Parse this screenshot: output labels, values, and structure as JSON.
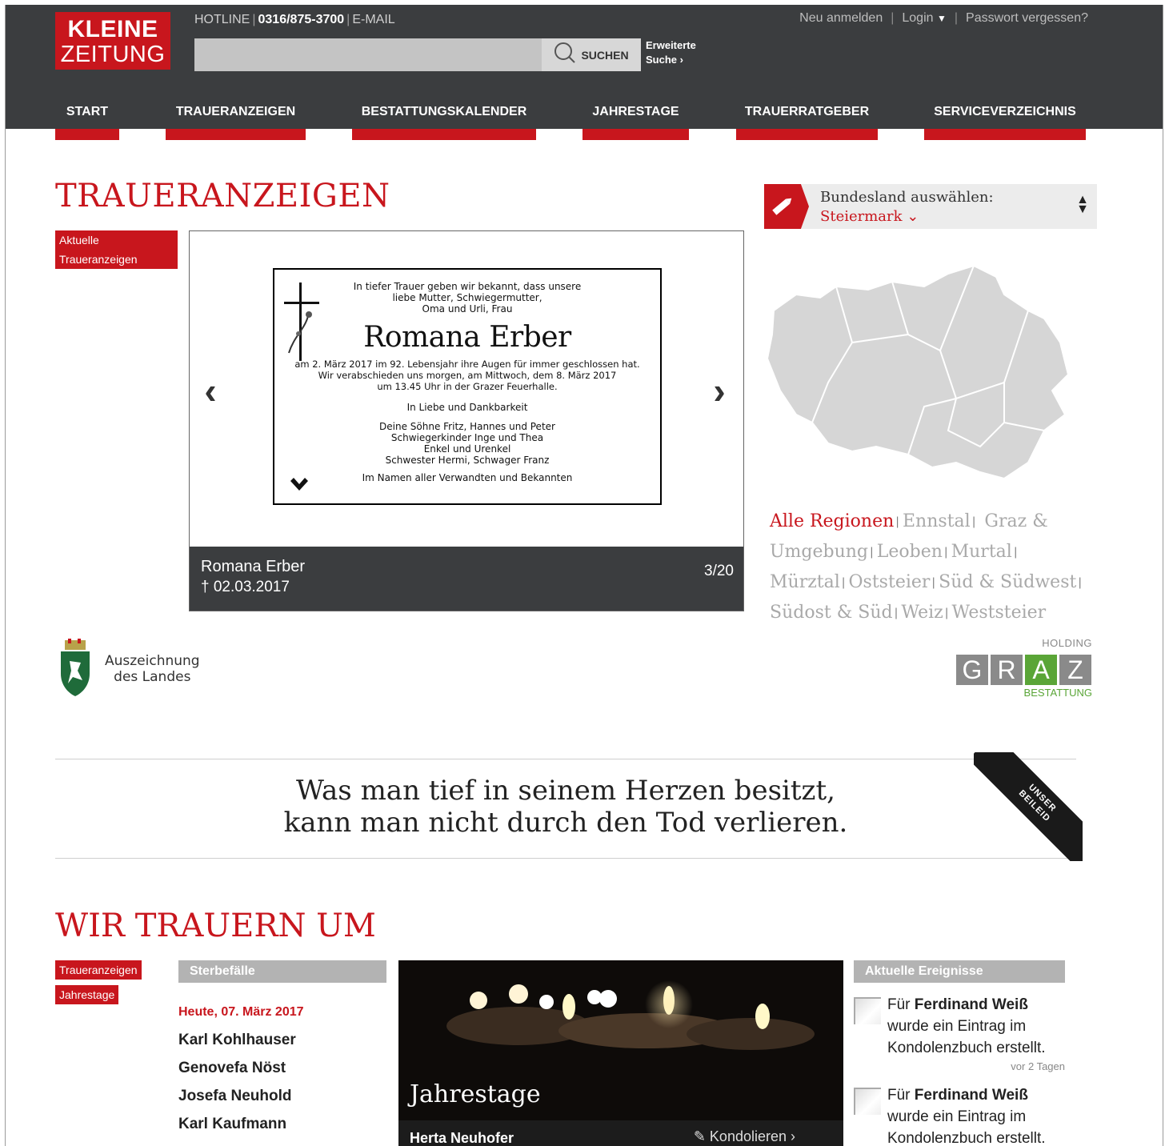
{
  "header": {
    "logo_line1": "KLEINE",
    "logo_line2": "ZEITUNG",
    "hotline_label": "HOTLINE",
    "hotline_number": "0316/875-3700",
    "email_label": "E-MAIL",
    "search_placeholder": "",
    "search_button": "SUCHEN",
    "advanced_line1": "Erweiterte",
    "advanced_line2": "Suche ›",
    "register": "Neu anmelden",
    "login": "Login",
    "forgot_password": "Passwort vergessen?"
  },
  "nav": [
    {
      "label": "START"
    },
    {
      "label": "TRAUERANZEIGEN"
    },
    {
      "label": "BESTATTUNGSKALENDER"
    },
    {
      "label": "JAHRESTAGE"
    },
    {
      "label": "TRAUERRATGEBER"
    },
    {
      "label": "SERVICEVERZEICHNIS"
    }
  ],
  "trauer": {
    "heading": "TRAUERANZEIGEN",
    "tag_line1": "Aktuelle",
    "tag_line2": "Traueranzeigen",
    "notice": {
      "intro": "In tiefer Trauer geben wir bekannt, dass unsere\nliebe Mutter, Schwiegermutter,\nOma und Urli, Frau",
      "name": "Romana Erber",
      "body": "am 2. März 2017 im 92. Lebensjahr ihre Augen für immer geschlossen hat.\nWir verabschieden uns morgen, am Mittwoch, dem 8. März 2017\num 13.45 Uhr in der Grazer Feuerhalle.",
      "thanks": "In Liebe und Dankbarkeit",
      "family": "Deine Söhne Fritz, Hannes und Peter\nSchwiegerkinder Inge und Thea\nEnkel und Urenkel\nSchwester Hermi, Schwager Franz",
      "foot": "Im Namen aller Verwandten und Bekannten"
    },
    "caption_name": "Romana Erber",
    "caption_date": "† 02.03.2017",
    "counter": "3/20"
  },
  "region": {
    "label": "Bundesland auswählen:",
    "selected": "Steiermark ⌄",
    "items": [
      {
        "label": "Alle Regionen",
        "active": true
      },
      {
        "label": "Ennstal"
      },
      {
        "label": "Graz & Umgebung"
      },
      {
        "label": "Leoben"
      },
      {
        "label": "Murtal"
      },
      {
        "label": "Mürztal"
      },
      {
        "label": "Oststeier"
      },
      {
        "label": "Süd & Südwest"
      },
      {
        "label": "Südost & Süd"
      },
      {
        "label": "Weiz"
      },
      {
        "label": "Weststeier"
      }
    ]
  },
  "award": {
    "line1": "Auszeichnung",
    "line2": "des Landes"
  },
  "holding": {
    "top": "HOLDING",
    "letters": [
      "G",
      "R",
      "A",
      "Z"
    ],
    "bottom": "BESTATTUNG"
  },
  "quote": {
    "text": "Was man tief in seinem Herzen besitzt,\nkann man nicht durch den Tod verlieren.",
    "ribbon_line1": "UNSER",
    "ribbon_line2": "BEILEID"
  },
  "wir": {
    "heading": "WIR TRAUERN UM",
    "tag1": "Traueranzeigen",
    "tag2": "Jahrestage",
    "deaths_head": "Sterbefälle",
    "deaths_date": "Heute, 07. März 2017",
    "deaths": [
      "Karl Kohlhauser",
      "Genovefa Nöst",
      "Josefa Neuhold",
      "Karl Kaufmann"
    ],
    "jahrestage_title": "Jahrestage",
    "jahrestage_name": "Herta Neuhofer",
    "kondolieren": "✎ Kondolieren ›",
    "events_head": "Aktuelle Ereignisse",
    "events": [
      {
        "pre": "Für ",
        "name": "Ferdinand Weiß",
        "text": " wurde ein Eintrag im Kondolenzbuch erstellt.",
        "time": "vor 2 Tagen"
      },
      {
        "pre": "Für ",
        "name": "Ferdinand Weiß",
        "text": " wurde ein Eintrag im Kondolenzbuch erstellt.",
        "time": ""
      }
    ]
  }
}
